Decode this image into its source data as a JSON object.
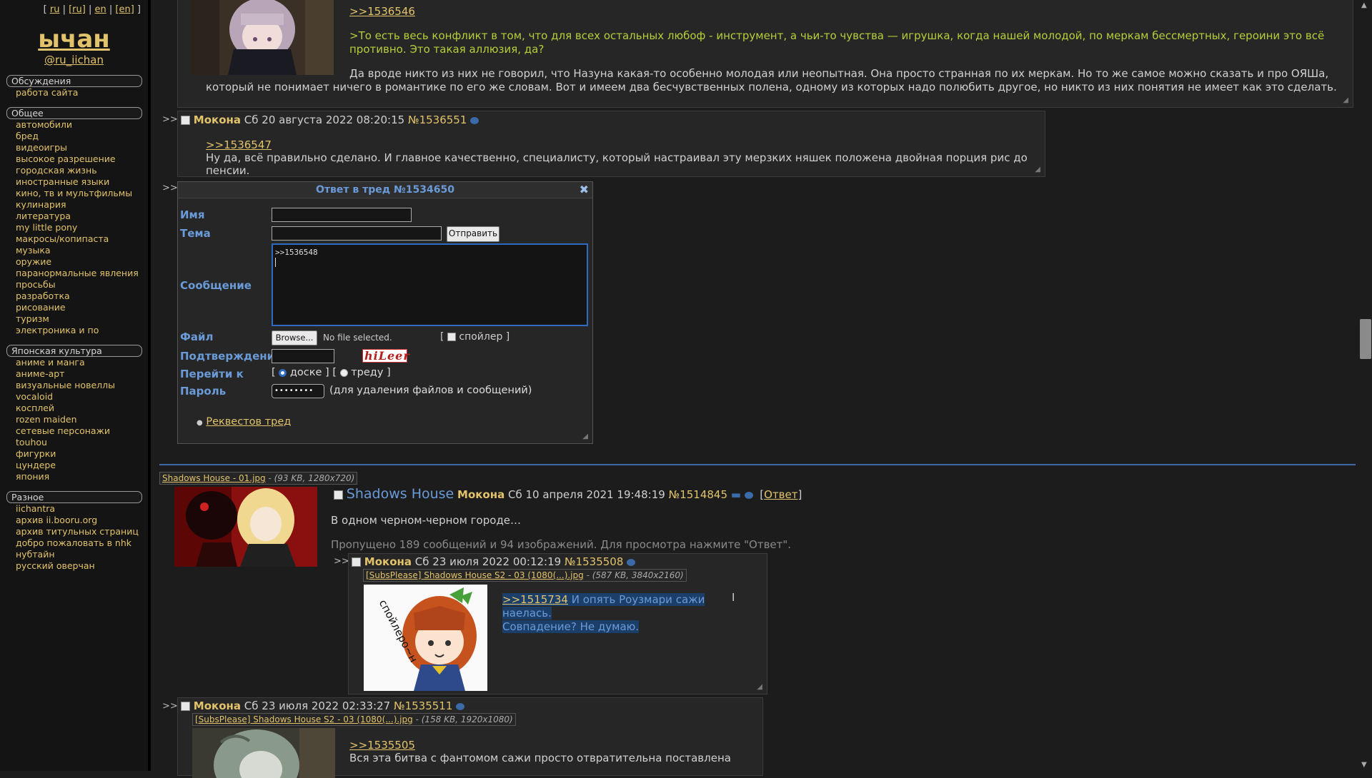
{
  "sidebar": {
    "langs": [
      "ru",
      "[ru]",
      "en",
      "[en]"
    ],
    "logo": "ычан",
    "handle": "@ru_iichan",
    "categories": [
      {
        "title": "Обсуждения",
        "items": [
          "работа сайта"
        ]
      },
      {
        "title": "Общее",
        "items": [
          "автомобили",
          "бред",
          "видеоигры",
          "высокое разрешение",
          "городская жизнь",
          "иностранные языки",
          "кино, тв и мультфильмы",
          "кулинария",
          "литература",
          "my little pony",
          "макросы/копипаста",
          "музыка",
          "оружие",
          "паранормальные явления",
          "просьбы",
          "разработка",
          "рисование",
          "туризм",
          "электроника и по"
        ]
      },
      {
        "title": "Японская культура",
        "items": [
          "аниме и манга",
          "аниме-арт",
          "визуальные новеллы",
          "vocaloid",
          "косплей",
          "rozen maiden",
          "сетевые персонажи",
          "touhou",
          "фигурки",
          "цундере",
          "япония"
        ]
      },
      {
        "title": "Разное",
        "items": [
          "iichantra",
          "архив ii.booru.org",
          "архив титульных страниц",
          "добро пожаловать в nhk",
          "нубтайн",
          "русский оверчан"
        ]
      }
    ]
  },
  "post1": {
    "quote": ">>1536546",
    "greentext": ">То есть весь конфликт в том, что для всех остальных любоф - инструмент, а чьи-то чувства — игрушка, когда нашей молодой, по меркам бессмертных, героини это всё противно. Это такая аллюзия, да?",
    "text": "Да вроде никто из них не говорил, что Назуна какая-то особенно молодая или неопытная. Она просто странная по их меркам. Но то же самое можно сказать и про ОЯШа, который не понимает ничего в романтике по его же словам. Вот и имеем два бесчувственных полена, одному из которых надо полюбить другое, но никто из них понятия не имеет как это сделать."
  },
  "post2": {
    "name": "Мокона",
    "date": "Сб 20 августа 2022 08:20:15",
    "num": "№1536551",
    "quote": ">>1536547",
    "text": "Ну да, всё правильно сделано. И главное качественно, специалисту, который настраивал эту мерзких няшек положена двойная порция рис до пенсии."
  },
  "reply_form": {
    "title": "Ответ в тред №1534650",
    "close": "✖",
    "name_label": "Имя",
    "subject_label": "Тема",
    "submit": "Отправить",
    "message_label": "Сообщение",
    "message_value": ">>1536548",
    "file_label": "Файл",
    "browse": "Browse...",
    "no_file": "No file selected.",
    "spoiler": "спойлер",
    "captcha_label": "Подтверждение",
    "captcha_text": "hiLeer",
    "goto_label": "Перейти к",
    "goto_board": "доске",
    "goto_thread": "треду",
    "password_label": "Пароль",
    "password_value": "••••••••",
    "password_hint": "(для удаления файлов и сообщений)",
    "request_link": "Реквестов тред"
  },
  "thread": {
    "file_name": "Shadows House - 01.jpg",
    "file_meta": "(93 KB, 1280x720)",
    "subject": "Shadows House",
    "name": "Мокона",
    "date": "Сб 10 апреля 2021 19:48:19",
    "num": "№1514845",
    "reply_link": "Ответ",
    "text": "В одном черном-черном городе…",
    "omitted": "Пропущено 189 сообщений и 94 изображений. Для просмотра нажмите \"Ответ\"."
  },
  "post3": {
    "name": "Мокона",
    "date": "Сб 23 июля 2022 00:12:19",
    "num": "№1535508",
    "file_name": "[SubsPlease] Shadows House S2 - 03 (1080(...).jpg",
    "file_meta": "(587 KB, 3840x2160)",
    "spoiler_text": "спойлеро~н",
    "quote": ">>1515734",
    "text1": "И опять Роузмари сажи наелась.",
    "text2": "Совпадение? Не думаю."
  },
  "post4": {
    "name": "Мокона",
    "date": "Сб 23 июля 2022 02:33:27",
    "num": "№1535511",
    "file_name": "[SubsPlease] Shadows House S2 - 03 (1080(...).jpg",
    "file_meta": "(158 KB, 1920x1080)",
    "quote": ">>1535505",
    "text": "Вся эта битва с фантомом сажи просто отвратительна поставлена"
  },
  "arrows": ">>",
  "colors": {
    "accent": "#e2c36b",
    "link_blue": "#6a9bd8",
    "greentext": "#b8cd3a",
    "separator": "#3a6aa8"
  }
}
